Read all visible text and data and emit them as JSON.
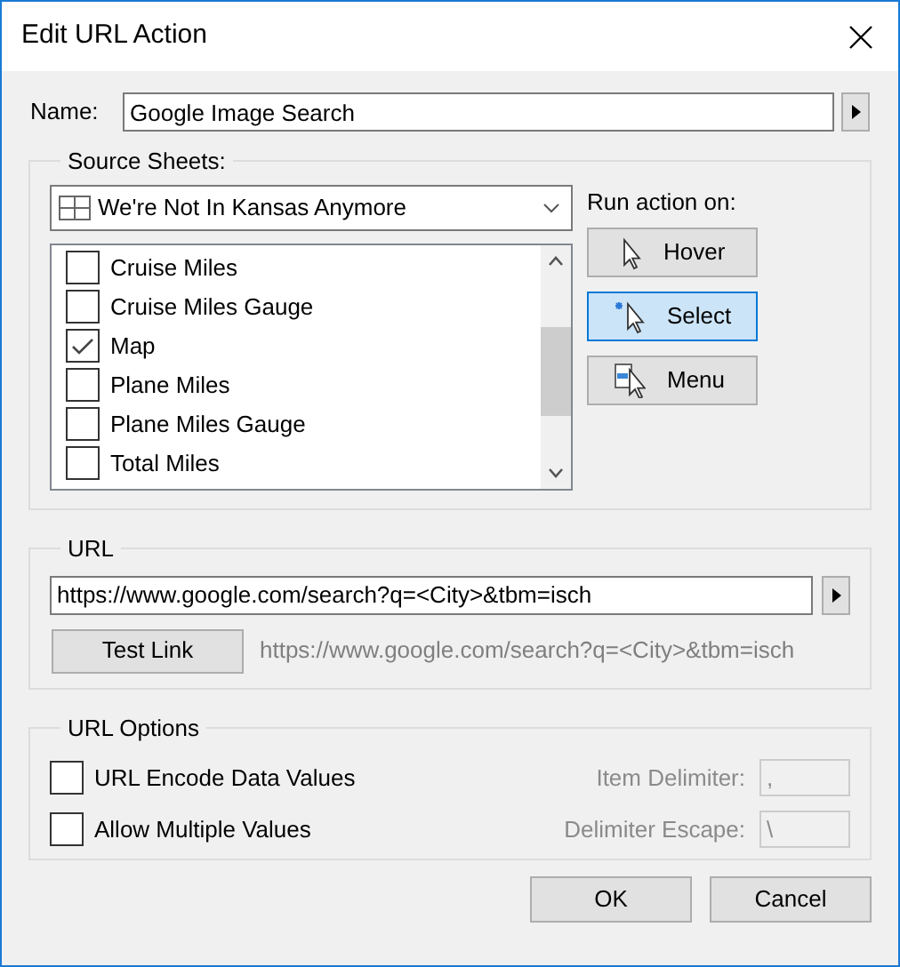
{
  "window": {
    "title": "Edit URL Action"
  },
  "name": {
    "label": "Name:",
    "value": "Google Image Search"
  },
  "source_sheets": {
    "legend": "Source Sheets:",
    "dashboard": "We're Not In Kansas Anymore",
    "sheets": [
      {
        "label": "Cruise Miles",
        "checked": false
      },
      {
        "label": "Cruise Miles Gauge",
        "checked": false
      },
      {
        "label": "Map",
        "checked": true
      },
      {
        "label": "Plane Miles",
        "checked": false
      },
      {
        "label": "Plane Miles Gauge",
        "checked": false
      },
      {
        "label": "Total Miles",
        "checked": false
      }
    ],
    "run_action_label": "Run action on:",
    "run_actions": [
      {
        "label": "Hover",
        "kind": "hover",
        "selected": false
      },
      {
        "label": "Select",
        "kind": "select",
        "selected": true
      },
      {
        "label": "Menu",
        "kind": "menu",
        "selected": false
      }
    ]
  },
  "url": {
    "legend": "URL",
    "value": "https://www.google.com/search?q=<City>&tbm=isch",
    "test_button": "Test Link",
    "preview": "https://www.google.com/search?q=<City>&tbm=isch"
  },
  "url_options": {
    "legend": "URL Options",
    "checkboxes": [
      {
        "label": "URL Encode Data Values",
        "checked": false
      },
      {
        "label": "Allow Multiple Values",
        "checked": false
      }
    ],
    "fields": [
      {
        "label": "Item Delimiter:",
        "value": ","
      },
      {
        "label": "Delimiter Escape:",
        "value": "\\"
      }
    ]
  },
  "buttons": [
    "OK",
    "Cancel"
  ]
}
